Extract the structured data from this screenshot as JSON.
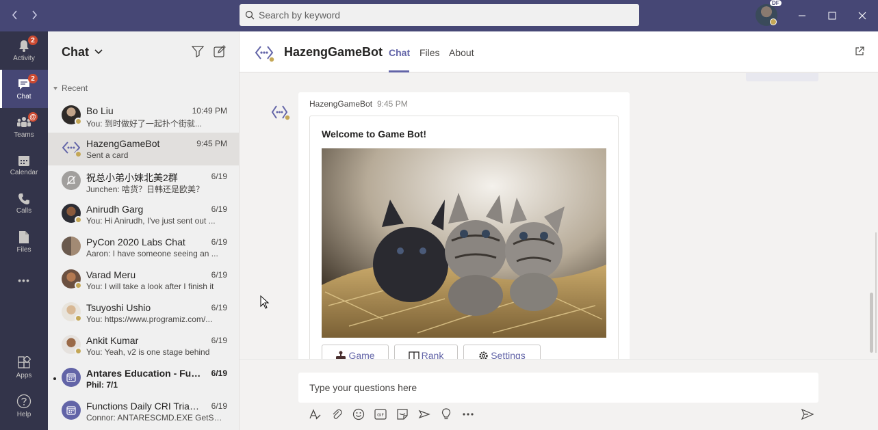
{
  "titlebar": {
    "search_placeholder": "Search by keyword",
    "profile_initials": "DF",
    "back_icon": "chevron-left-icon",
    "forward_icon": "chevron-right-icon"
  },
  "rail": {
    "items": [
      {
        "label": "Activity",
        "badge": "2",
        "icon": "bell-icon"
      },
      {
        "label": "Chat",
        "badge": "2",
        "icon": "chat-icon"
      },
      {
        "label": "Teams",
        "badge": "@",
        "icon": "teams-icon"
      },
      {
        "label": "Calendar",
        "badge": "",
        "icon": "calendar-icon"
      },
      {
        "label": "Calls",
        "badge": "",
        "icon": "phone-icon"
      },
      {
        "label": "Files",
        "badge": "",
        "icon": "file-icon"
      },
      {
        "label": "Apps",
        "badge": "",
        "icon": "apps-icon"
      },
      {
        "label": "Help",
        "badge": "",
        "icon": "help-icon"
      }
    ],
    "more_glyph": "•••"
  },
  "chatlist": {
    "title": "Chat",
    "section": "Recent",
    "items": [
      {
        "name": "Bo Liu",
        "preview": "You: 到时做好了一起扑个街就...",
        "time": "10:49 PM"
      },
      {
        "name": "HazengGameBot",
        "preview": "Sent a card",
        "time": "9:45 PM"
      },
      {
        "name": "祝总小弟小妹北美2群",
        "preview": "Junchen: 啥货？日韩还是欧美？",
        "time": "6/19"
      },
      {
        "name": "Anirudh Garg",
        "preview": "You: Hi Anirudh, I've just sent out ...",
        "time": "6/19"
      },
      {
        "name": "PyCon 2020 Labs Chat",
        "preview": "Aaron: I have someone seeing an ...",
        "time": "6/19"
      },
      {
        "name": "Varad Meru",
        "preview": "You: I will take a look after I finish it",
        "time": "6/19"
      },
      {
        "name": "Tsuyoshi Ushio",
        "preview": "You: https://www.programiz.com/...",
        "time": "6/19"
      },
      {
        "name": "Ankit Kumar",
        "preview": "You: Yeah, v2 is one stage behind",
        "time": "6/19"
      },
      {
        "name": "Antares Education - Fun...",
        "preview": "Phil: 7/1",
        "time": "6/19"
      },
      {
        "name": "Functions Daily CRI Triage...",
        "preview": "Connor: ANTARESCMD.EXE GetSit...",
        "time": "6/19"
      }
    ]
  },
  "header": {
    "title": "HazengGameBot",
    "tabs": [
      "Chat",
      "Files",
      "About"
    ]
  },
  "message": {
    "sender": "HazengGameBot",
    "time": "9:45 PM",
    "card_title": "Welcome to Game Bot!",
    "buttons": [
      {
        "label": "Game",
        "icon": "joystick-icon"
      },
      {
        "label": "Rank",
        "icon": "book-icon"
      },
      {
        "label": "Settings",
        "icon": "gear-icon"
      }
    ]
  },
  "compose": {
    "placeholder": "Type your questions here"
  },
  "colors": {
    "titlebar": "#464775",
    "rail": "#33344a",
    "accent": "#6264a7",
    "badge": "#cc4a31"
  }
}
